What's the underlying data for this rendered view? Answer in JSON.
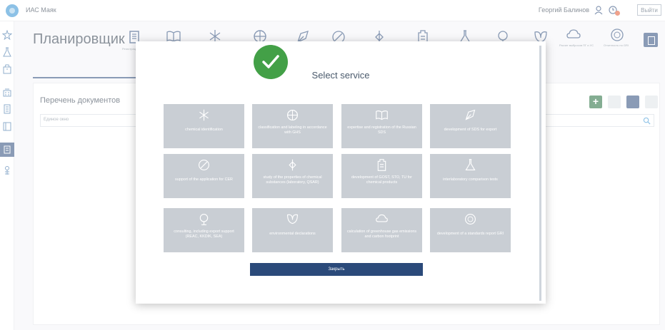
{
  "topbar": {
    "app_name": "ИАС Маяк",
    "user_name": "Георгий Балинов",
    "logout_label": "Выйти"
  },
  "header": {
    "title": "Планировщик",
    "tool_captions": {
      "sds_reg": "Регистрация",
      "carbon": "Расчет выбросов ПГ и УС",
      "gri": "Отчетность по GRI"
    }
  },
  "documents": {
    "title": "Перечень документов",
    "search_placeholder": "Единое окно"
  },
  "modal": {
    "title": "Select service",
    "services": [
      {
        "icon": "chemical-id-icon",
        "label": "chemical identification"
      },
      {
        "icon": "ghs-classification-icon",
        "label": "classification and labeling in accordance with GHS"
      },
      {
        "icon": "book-expertise-icon",
        "label": "expertise and registration of the Russian SDS"
      },
      {
        "icon": "sds-export-icon",
        "label": "development of SDS for export"
      },
      {
        "icon": "cer-support-icon",
        "label": "support of the application for CER"
      },
      {
        "icon": "properties-study-icon",
        "label": "study of the properties of chemical substances (laboratory, QSAR)"
      },
      {
        "icon": "gost-document-icon",
        "label": "development of GOST, STO, TU for chemical products"
      },
      {
        "icon": "flask-icon",
        "label": "interlaboratory comparison tests"
      },
      {
        "icon": "globe-consulting-icon",
        "label": "consulting, including export support (REAC, KKDIK, SEA)"
      },
      {
        "icon": "leaf-icon",
        "label": "environmental declarations"
      },
      {
        "icon": "co2-cloud-icon",
        "label": "calculation of greenhouse gas emissions and carbon footprint"
      },
      {
        "icon": "gri-icon",
        "label": "development of a standards report GRI"
      }
    ],
    "close_label": "Закрыть"
  },
  "colors": {
    "accent": "#2b4a7a",
    "card": "#c9ced4",
    "success": "#43a047",
    "add_button": "#1f6b3a",
    "notification": "#e4572e"
  }
}
